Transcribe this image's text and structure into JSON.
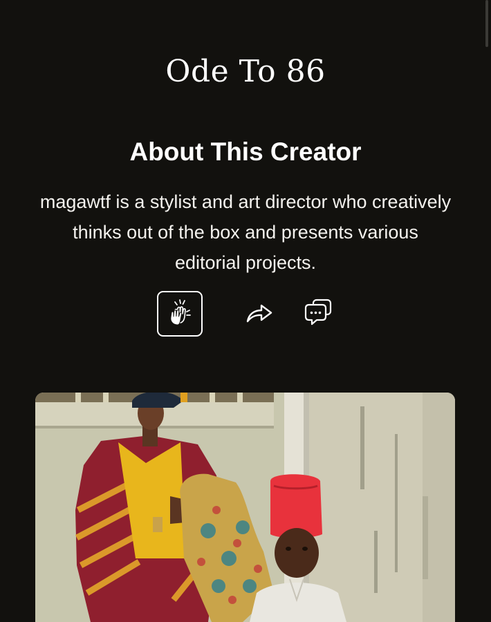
{
  "header": {
    "title": "Ode To 86"
  },
  "about": {
    "heading": "About This Creator",
    "description": "magawtf is a stylist and art director who creatively thinks out of the box and presents various editorial projects."
  },
  "actions": {
    "clap_icon": "clapping-hands-icon",
    "share_icon": "share-arrow-icon",
    "comment_icon": "chat-bubbles-icon"
  },
  "media": {
    "photo_subject": "editorial-photo"
  },
  "colors": {
    "background": "#12110e",
    "text": "#ffffff"
  }
}
